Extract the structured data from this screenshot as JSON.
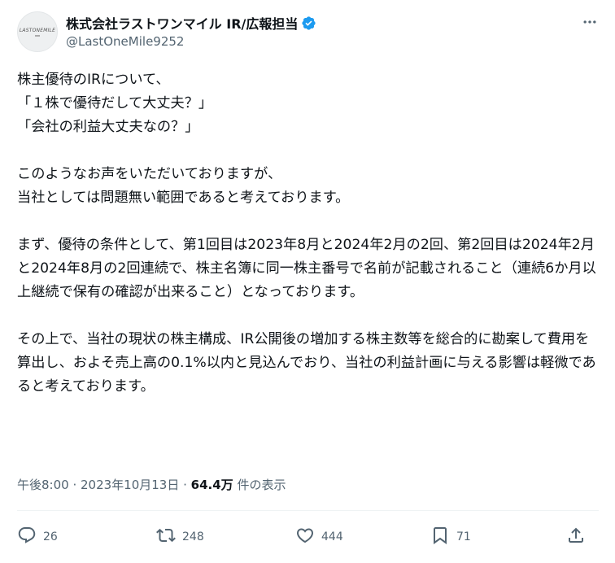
{
  "account": {
    "display_name": "株式会社ラストワンマイル IR/広報担当",
    "handle": "@LastOneMile9252",
    "avatar_text": "LASTONEMILE"
  },
  "tweet": {
    "text": "株主優待のIRについて、\n「１株で優待だして大丈夫？」\n「会社の利益大丈夫なの？」\n\nこのようなお声をいただいておりますが、\n当社としては問題無い範囲であると考えております。\n\nまず、優待の条件として、第1回目は2023年8月と2024年2月の2回、第2回目は2024年2月と2024年8月の2回連続で、株主名簿に同一株主番号で名前が記載されること（連続6か月以上継続で保有の確認が出来ること）となっております。\n\nその上で、当社の現状の株主構成、IR公開後の増加する株主数等を総合的に勘案して費用を算出し、およそ売上高の0.1%以内と見込んでおり、当社の利益計画に与える影響は軽微であると考えております。"
  },
  "meta": {
    "time": "午後8:00",
    "separator": " · ",
    "date": "2023年10月13日",
    "views_count": "64.4万",
    "views_label": " 件の表示"
  },
  "actions": {
    "replies": "26",
    "reposts": "248",
    "likes": "444",
    "bookmarks": "71"
  },
  "colors": {
    "verified": "#1d9bf0",
    "secondary_text": "#536471",
    "primary_text": "#0f1419"
  },
  "icons": [
    "more-icon",
    "verified-badge-icon",
    "reply-icon",
    "repost-icon",
    "like-icon",
    "bookmark-icon",
    "share-icon"
  ]
}
